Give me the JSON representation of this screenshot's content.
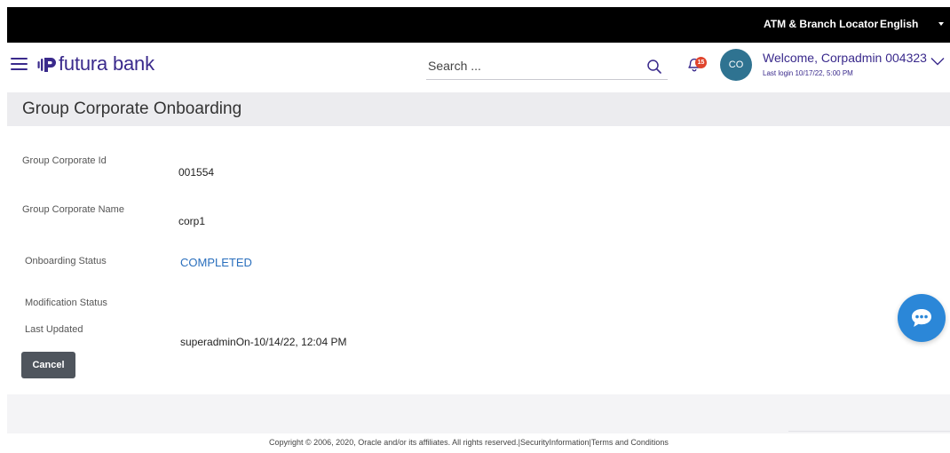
{
  "topbar": {
    "locator_label": "ATM & Branch Locator",
    "language_label": "English"
  },
  "header": {
    "brand_name": "futura bank",
    "search_placeholder": "Search ...",
    "notification_count": "15",
    "avatar_initials": "CO",
    "welcome_text": "Welcome, Corpadmin 004323",
    "last_login": "Last login 10/17/22, 5:00 PM"
  },
  "page": {
    "title": "Group Corporate Onboarding"
  },
  "details": {
    "corp_id_label": "Group Corporate Id",
    "corp_id_value": "001554",
    "corp_name_label": "Group Corporate Name",
    "corp_name_value": "corp1",
    "onboarding_label": "Onboarding Status",
    "onboarding_value": "COMPLETED",
    "modification_label": "Modification Status",
    "modification_value": "",
    "last_updated_label": "Last Updated",
    "last_updated_value": "superadminOn-10/14/22, 12:04 PM"
  },
  "actions": {
    "cancel_label": "Cancel"
  },
  "footer": {
    "copyright": "Copyright © 2006, 2020, Oracle and/or its affiliates. All rights reserved.",
    "security_link": "SecurityInformation",
    "terms_link": "Terms and Conditions"
  },
  "colors": {
    "brand": "#3a2a8c",
    "status": "#2a6fbd",
    "avatar": "#2f7391",
    "badge": "#e0442c",
    "chat": "#2b87d8",
    "button": "#4f555d"
  },
  "icons": [
    "hamburger-menu-icon",
    "futura-logo-icon",
    "search-icon",
    "bell-icon",
    "chevron-down-icon",
    "caret-down-icon",
    "chat-icon"
  ]
}
